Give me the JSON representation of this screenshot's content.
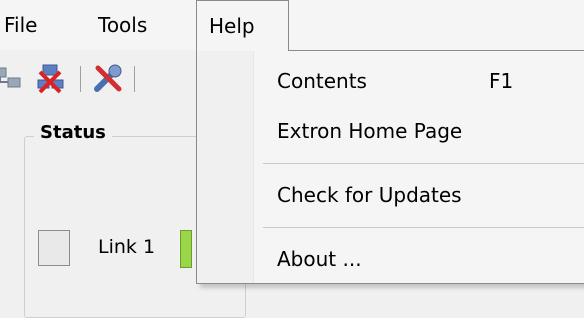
{
  "menubar": {
    "items": [
      {
        "label": "File"
      },
      {
        "label": "Tools"
      },
      {
        "label": "Help"
      }
    ]
  },
  "toolbar": {
    "icons": [
      "network-connect-icon",
      "network-disconnect-icon",
      "tools-icon"
    ]
  },
  "status_panel": {
    "group_title": "Status",
    "link_label": "Link 1"
  },
  "help_menu": {
    "items": [
      {
        "label": "Contents",
        "shortcut": "F1"
      },
      {
        "label": "Extron Home Page",
        "shortcut": ""
      },
      {
        "label": "Check for Updates",
        "shortcut": ""
      },
      {
        "label": "About ...",
        "shortcut": ""
      }
    ]
  },
  "colors": {
    "menu_background": "#f5f5f5",
    "menu_border": "#8a8a8a",
    "link_indicator": "#9bd64a"
  }
}
